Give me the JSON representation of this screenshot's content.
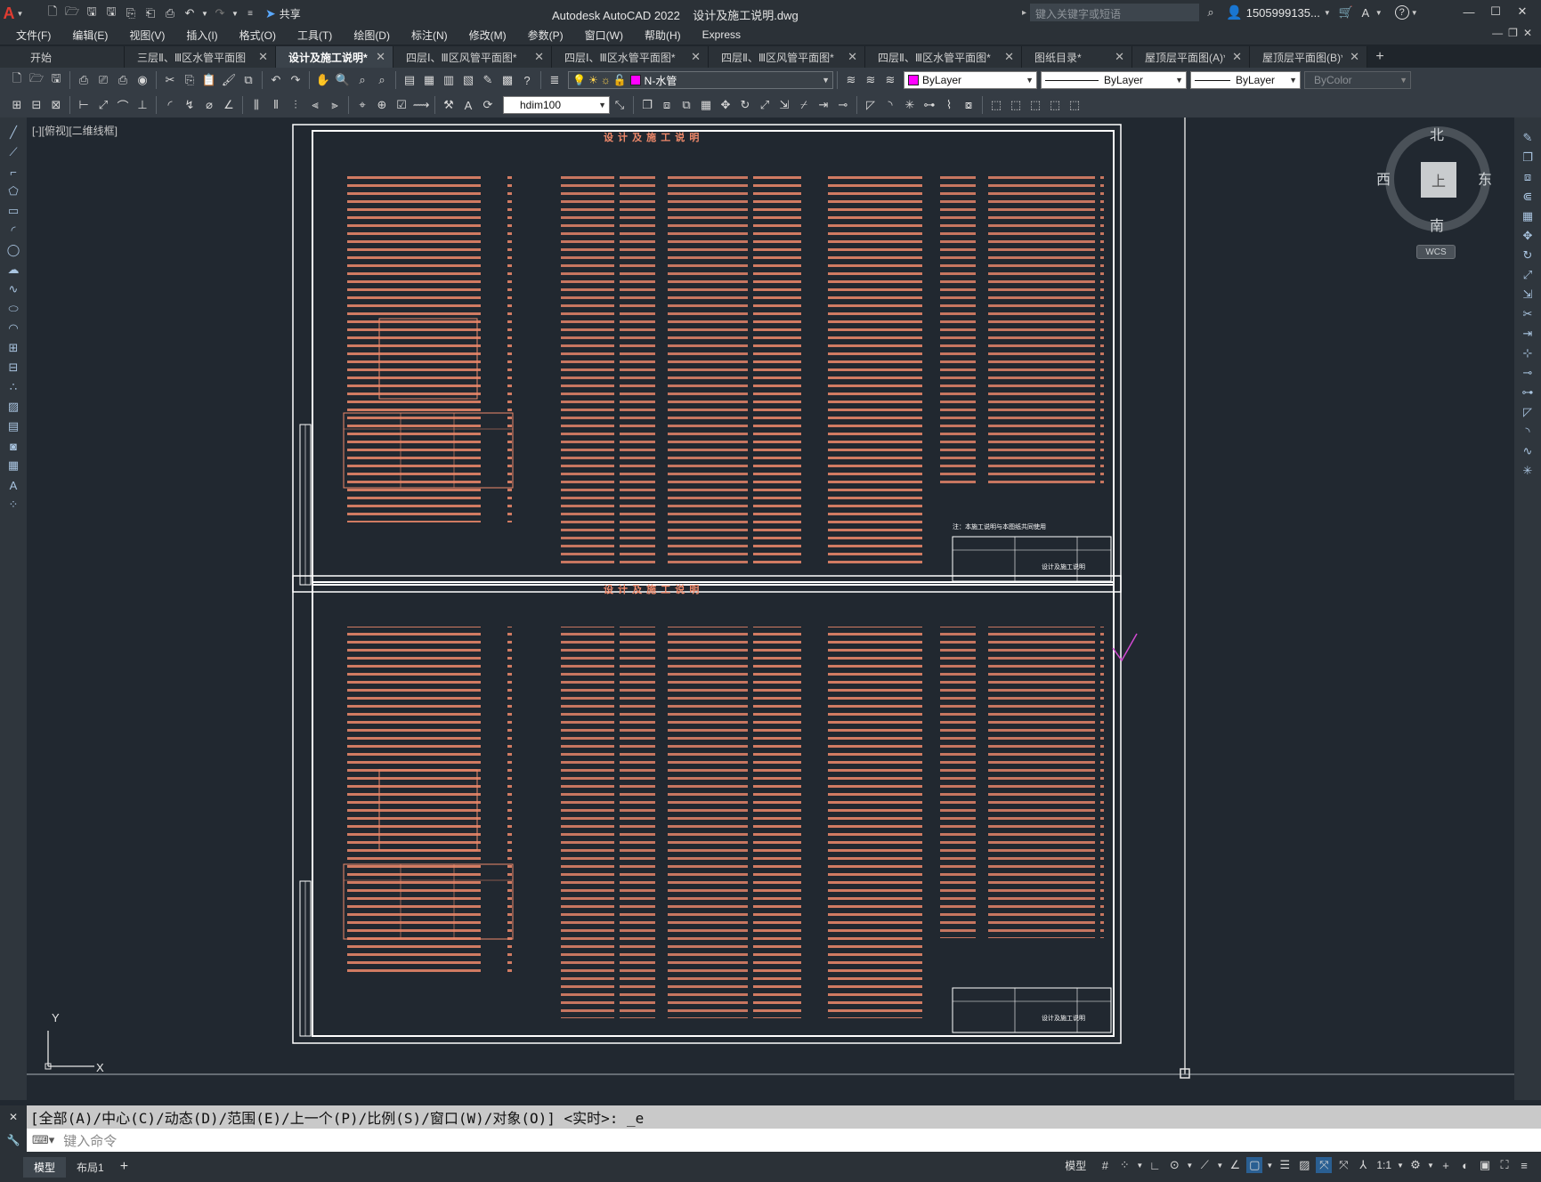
{
  "app": {
    "title": "Autodesk AutoCAD 2022    设计及施工说明.dwg",
    "share_label": "共享",
    "search_placeholder": "键入关键字或短语",
    "user": "1505999135...",
    "accent_color": "#e03c31"
  },
  "menu": [
    "文件(F)",
    "编辑(E)",
    "视图(V)",
    "插入(I)",
    "格式(O)",
    "工具(T)",
    "绘图(D)",
    "标注(N)",
    "修改(M)",
    "参数(P)",
    "窗口(W)",
    "帮助(H)",
    "Express"
  ],
  "tabs": [
    {
      "label": "开始",
      "closable": false
    },
    {
      "label": "三层Ⅱ、Ⅲ区水管平面图",
      "closable": true
    },
    {
      "label": "设计及施工说明*",
      "closable": true,
      "active": true
    },
    {
      "label": "四层Ⅰ、Ⅲ区风管平面图*",
      "closable": true
    },
    {
      "label": "四层Ⅰ、Ⅲ区水管平面图*",
      "closable": true
    },
    {
      "label": "四层Ⅱ、Ⅲ区风管平面图*",
      "closable": true
    },
    {
      "label": "四层Ⅱ、Ⅲ区水管平面图*",
      "closable": true
    },
    {
      "label": "图纸目录*",
      "closable": true
    },
    {
      "label": "屋顶层平面图(A)*",
      "closable": true
    },
    {
      "label": "屋顶层平面图(B)*",
      "closable": true
    }
  ],
  "toolbar": {
    "layer_value": "N-水管",
    "color_value": "ByLayer",
    "linetype_value": "ByLayer",
    "lineweight_value": "ByLayer",
    "plotstyle_value": "ByColor",
    "dimstyle_value": "hdim100"
  },
  "viewport": {
    "label": "[-][俯视][二维线框]",
    "drawing_title": "设 计 及 施 工 说 明",
    "note_text": "注：本施工说明与本图纸共同使用",
    "titleblock_name": "设计及施工说明"
  },
  "viewcube": {
    "north": "北",
    "south": "南",
    "east": "东",
    "west": "西",
    "face": "上",
    "wcs": "WCS"
  },
  "ucs": {
    "x": "X",
    "y": "Y"
  },
  "command": {
    "history": "[全部(A)/中心(C)/动态(D)/范围(E)/上一个(P)/比例(S)/窗口(W)/对象(O)] <实时>: _e",
    "placeholder": "键入命令"
  },
  "layouts": [
    "模型",
    "布局1"
  ],
  "status": {
    "model_label": "模型",
    "scale": "1:1"
  }
}
